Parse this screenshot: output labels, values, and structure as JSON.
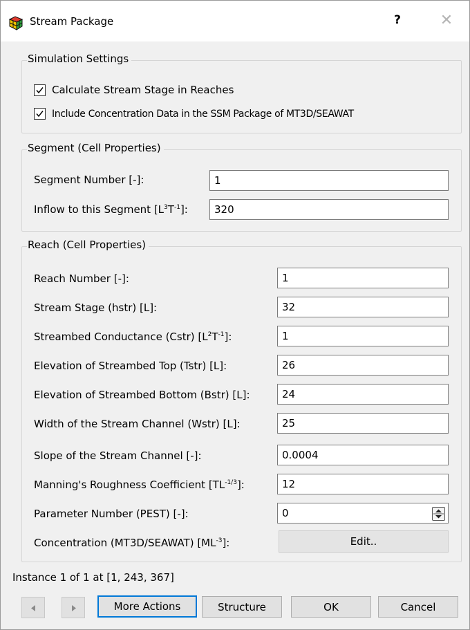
{
  "window": {
    "title": "Stream Package",
    "help_label": "?",
    "close_label": "✕"
  },
  "simulation": {
    "title": "Simulation Settings",
    "calc_stage": {
      "label": "Calculate Stream Stage in Reaches",
      "checked": true
    },
    "include_conc": {
      "label": "Include Concentration Data in the SSM Package of MT3D/SEAWAT",
      "checked": true
    }
  },
  "segment": {
    "title": "Segment (Cell Properties)",
    "number": {
      "label": "Segment Number [-]:",
      "value": "1"
    },
    "inflow": {
      "label_pre": "Inflow to this Segment [L",
      "sup1": "3",
      "label_mid": "T",
      "sup2": "-1",
      "label_post": "]:",
      "value": "320"
    }
  },
  "reach": {
    "title": "Reach (Cell Properties)",
    "number": {
      "label": "Reach Number [-]:",
      "value": "1"
    },
    "stage": {
      "label": "Stream Stage (hstr) [L]:",
      "value": "32"
    },
    "conductance": {
      "label_pre": "Streambed Conductance (Cstr) [L",
      "sup1": "2",
      "label_mid": "T",
      "sup2": "-1",
      "label_post": "]:",
      "value": "1"
    },
    "top": {
      "label": "Elevation of Streambed Top (Tstr) [L]:",
      "value": "26"
    },
    "bottom": {
      "label": "Elevation of Streambed Bottom (Bstr) [L]:",
      "value": "24"
    },
    "width": {
      "label": "Width of the Stream Channel (Wstr) [L]:",
      "value": "25"
    },
    "slope": {
      "label": "Slope of the Stream Channel [-]:",
      "value": "0.0004"
    },
    "manning": {
      "label_pre": "Manning's Roughness Coefficient [TL",
      "sup1": "-1/3",
      "label_post": "]:",
      "value": "12"
    },
    "pest": {
      "label": "Parameter Number (PEST) [-]:",
      "value": "0"
    },
    "concentration": {
      "label_pre": "Concentration (MT3D/SEAWAT) [ML",
      "sup1": "-3",
      "label_post": "]:",
      "button": "Edit.."
    }
  },
  "status": "Instance 1 of 1 at [1, 243, 367]",
  "buttons": {
    "more_actions": "More Actions",
    "structure": "Structure",
    "ok": "OK",
    "cancel": "Cancel"
  },
  "colors": {
    "dialog_bg": "#f0f0f0",
    "default_button_border": "#0078d7"
  },
  "icons": {
    "app": "stream-package-icon",
    "prev": "triangle-left-icon",
    "next": "triangle-right-icon"
  }
}
